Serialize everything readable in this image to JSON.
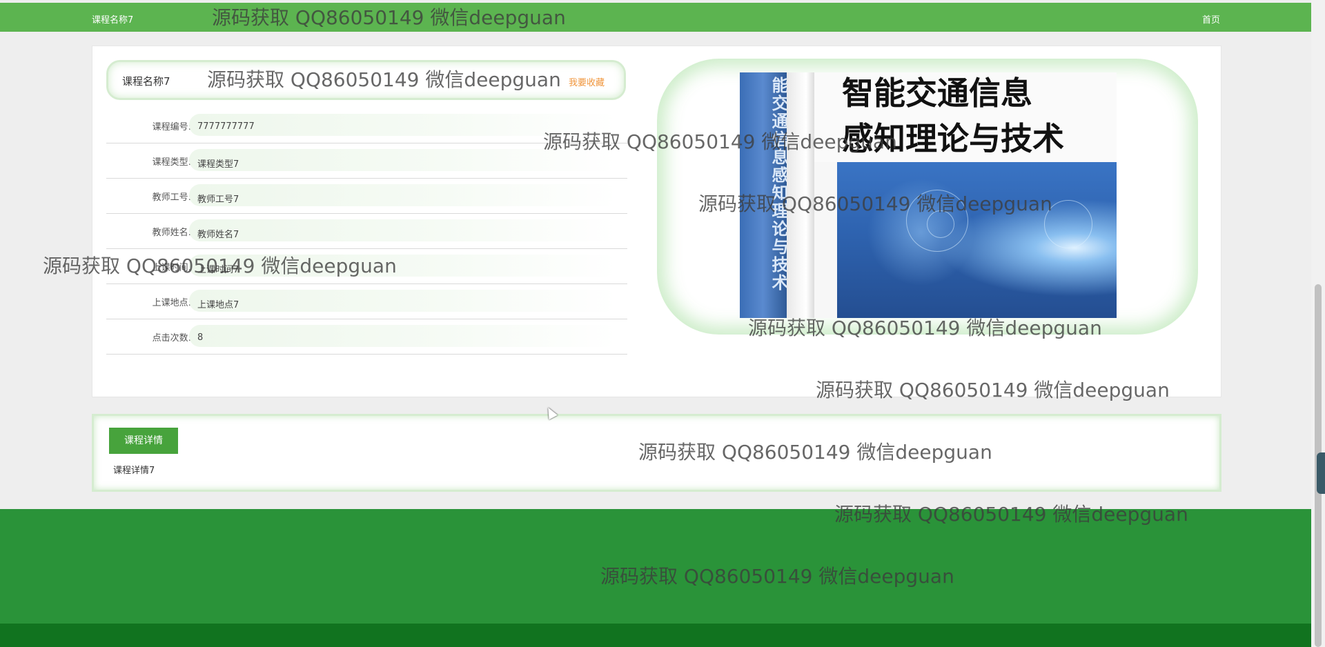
{
  "nav": {
    "brand": "课程名称7",
    "home": "首页"
  },
  "course": {
    "title": "课程名称7",
    "favorite_label": "我要收藏",
    "fields": [
      {
        "label": "课程编号:",
        "value": "7777777777"
      },
      {
        "label": "课程类型:",
        "value": "课程类型7"
      },
      {
        "label": "教师工号:",
        "value": "教师工号7"
      },
      {
        "label": "教师姓名:",
        "value": "教师姓名7"
      },
      {
        "label": "上课时间:",
        "value": "上课时间7"
      },
      {
        "label": "上课地点:",
        "value": "上课地点7"
      },
      {
        "label": "点击次数:",
        "value": "8"
      }
    ]
  },
  "carousel": {
    "spine_text": "能交通信息感知理论与技术",
    "cover_line1": "智能交通信息",
    "cover_line2": "感知理论与技术",
    "slide_count": 3,
    "active_index": 0
  },
  "detail": {
    "tab_label": "课程详情",
    "content": "课程详情7"
  },
  "watermark": "源码获取 QQ86050149 微信deepguan",
  "colors": {
    "nav_green": "#5cb450",
    "tab_green": "#47a33c",
    "footer_green": "#2a9339",
    "footer_dark": "#11731f",
    "favorite_orange": "#f0953a"
  }
}
